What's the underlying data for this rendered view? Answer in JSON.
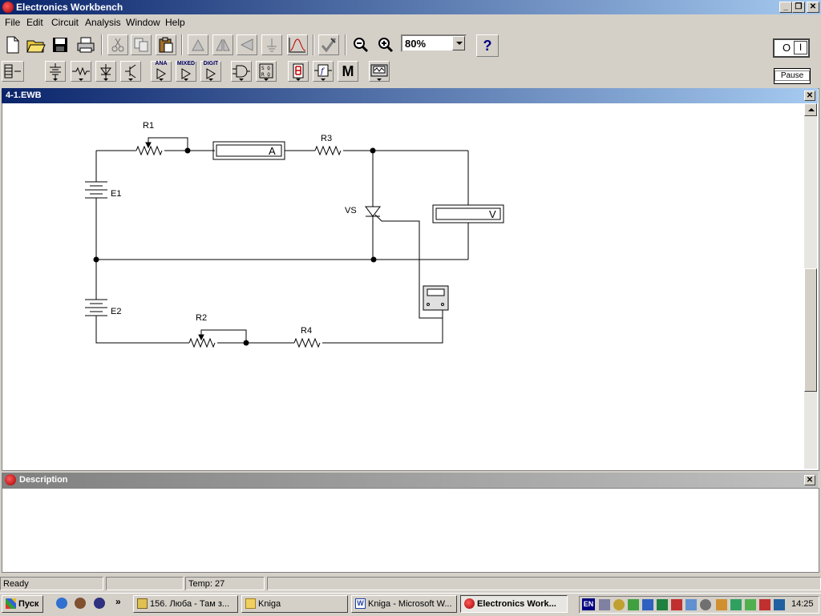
{
  "app": {
    "title": "Electronics Workbench"
  },
  "menu": [
    "File",
    "Edit",
    "Circuit",
    "Analysis",
    "Window",
    "Help"
  ],
  "toolbar": {
    "zoom": "80%",
    "help": "?",
    "pause": "Pause",
    "power_off": "O",
    "power_on": "I",
    "bin_labels": {
      "analog": "ANA",
      "mixed": "MIXED",
      "digital": "DIGIT",
      "misc": "M"
    }
  },
  "document": {
    "title": "4-1.EWB",
    "circuit": {
      "labels": {
        "r1": "R1",
        "r2": "R2",
        "r3": "R3",
        "r4": "R4",
        "e1": "E1",
        "e2": "E2",
        "vs": "VS",
        "ammeter": "A",
        "voltmeter": "V"
      }
    }
  },
  "description": {
    "title": "Description",
    "body": ""
  },
  "status": {
    "ready": "Ready",
    "temp": "Temp:  27"
  },
  "taskbar": {
    "start": "Пуск",
    "quick_more": "»",
    "tasks": [
      {
        "label": "156. Люба - Там з..."
      },
      {
        "label": "Kniga"
      },
      {
        "label": "Kniga - Microsoft W..."
      },
      {
        "label": "Electronics Work..."
      }
    ],
    "lang": "EN",
    "clock": "14:25"
  },
  "colors": {
    "title_start": "#0a246a",
    "title_end": "#a6caf0",
    "face": "#d4d0c8"
  }
}
